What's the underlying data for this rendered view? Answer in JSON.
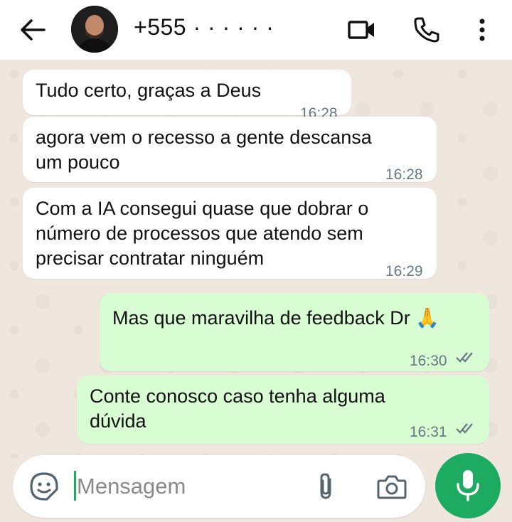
{
  "header": {
    "contact_name": "+555 · · · · · ·",
    "back_icon": "arrow-left-icon",
    "video_icon": "video-call-icon",
    "call_icon": "phone-icon",
    "menu_icon": "more-vert-icon"
  },
  "messages": [
    {
      "direction": "in",
      "text": "Tudo certo, graças a Deus",
      "time": "16:28"
    },
    {
      "direction": "in",
      "text": "agora vem o recesso a gente descansa\num pouco",
      "time": "16:28"
    },
    {
      "direction": "in",
      "text": "Com a IA consegui quase que dobrar o\nnúmero de processos que atendo sem\nprecisar contratar ninguém",
      "time": "16:29"
    },
    {
      "direction": "out",
      "text": "Mas que maravilha de feedback Dr 🙏",
      "time": "16:30",
      "status": "read"
    },
    {
      "direction": "out",
      "text": "Conte conosco caso tenha alguma\ndúvida",
      "time": "16:31",
      "status": "read"
    }
  ],
  "composer": {
    "placeholder": "Mensagem",
    "sticker_icon": "sticker-icon",
    "attach_icon": "paperclip-icon",
    "camera_icon": "camera-icon",
    "mic_icon": "microphone-icon"
  },
  "colors": {
    "outgoing_bubble": "#d9fdd3",
    "incoming_bubble": "#ffffff",
    "accent": "#1daa61",
    "tick": "#667781"
  }
}
